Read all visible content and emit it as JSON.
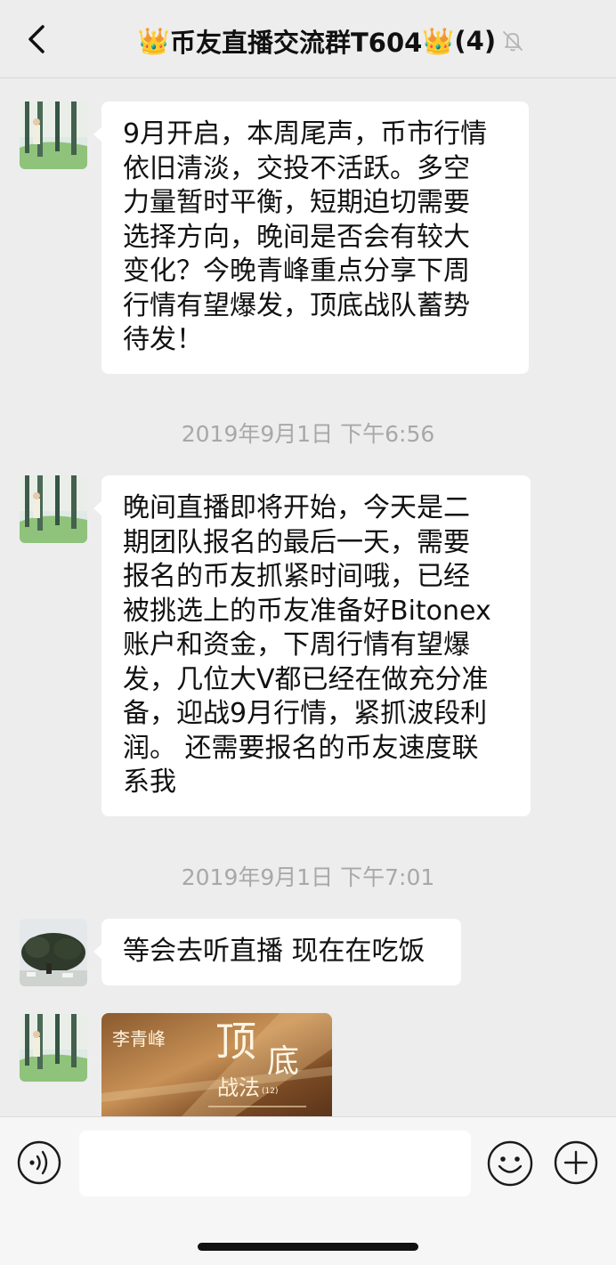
{
  "header": {
    "back_icon": "chevron-left-icon",
    "crown_left": "👑",
    "title": "币友直播交流群T604",
    "crown_right": "👑",
    "member_count": "(4)",
    "mute_icon": "bell-slash-icon"
  },
  "messages": [
    {
      "type": "text",
      "lines": [
        "9月开启，本周尾声，币市行情",
        "依旧清淡，交投不活跃。多空",
        "力量暂时平衡，短期迫切需要",
        "选择方向，晚间是否会有较大",
        "变化？今晚青峰重点分享下周",
        "行情有望爆发，顶底战队蓄势",
        "待发！"
      ]
    },
    {
      "type": "text",
      "lines": [
        "晚间直播即将开始，今天是二",
        "期团队报名的最后一天，需要",
        "报名的币友抓紧时间哦，已经",
        "被挑选上的币友准备好Bitonex",
        "账户和资金，下周行情有望爆",
        "发，几位大V都已经在做充分准",
        "备，迎战9月行情，紧抓波段利",
        "润。 还需要报名的币友速度联",
        "系我"
      ]
    },
    {
      "type": "text",
      "lines": [
        "等会去听直播 现在在吃饭"
      ]
    },
    {
      "type": "image",
      "caption_main": "顶",
      "caption_side": "底",
      "caption_sub": "战法",
      "caption_author": "李青峰",
      "caption_tag": "(12)"
    }
  ],
  "timestamps": [
    "2019年9月1日 下午6:56",
    "2019年9月1日 下午7:01"
  ],
  "input_bar": {
    "voice_icon": "voice-icon",
    "input_value": "",
    "emoji_icon": "emoji-icon",
    "plus_icon": "plus-circle-icon"
  }
}
